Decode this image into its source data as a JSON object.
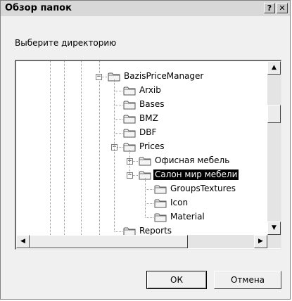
{
  "window": {
    "title": "Обзор папок",
    "help_label": "?",
    "close_label": "✕"
  },
  "prompt": "Выберите директорию",
  "tree": {
    "items": [
      {
        "label": "BazisPriceManager",
        "depth": 0,
        "expanded": true,
        "selected": false
      },
      {
        "label": "Arxib",
        "depth": 1,
        "expanded": null,
        "selected": false
      },
      {
        "label": "Bases",
        "depth": 1,
        "expanded": null,
        "selected": false
      },
      {
        "label": "BMZ",
        "depth": 1,
        "expanded": null,
        "selected": false
      },
      {
        "label": "DBF",
        "depth": 1,
        "expanded": null,
        "selected": false
      },
      {
        "label": "Prices",
        "depth": 1,
        "expanded": true,
        "selected": false
      },
      {
        "label": "Офисная мебель",
        "depth": 2,
        "expanded": false,
        "selected": false
      },
      {
        "label": "Салон мир мебели",
        "depth": 2,
        "expanded": true,
        "selected": true
      },
      {
        "label": "GroupsTextures",
        "depth": 3,
        "expanded": null,
        "selected": false
      },
      {
        "label": "Icon",
        "depth": 3,
        "expanded": null,
        "selected": false
      },
      {
        "label": "Material",
        "depth": 3,
        "expanded": null,
        "selected": false
      },
      {
        "label": "Reports",
        "depth": 1,
        "expanded": null,
        "selected": false
      }
    ]
  },
  "scrollbars": {
    "up_arrow": "▲",
    "down_arrow": "▼",
    "left_arrow": "◀",
    "right_arrow": "▶"
  },
  "buttons": {
    "ok_label": "ОК",
    "cancel_label": "Отмена"
  },
  "colors": {
    "dialog_bg": "#f0f0f0",
    "selection_bg": "#000000",
    "selection_text": "#ffffff"
  },
  "icons": {
    "folder": "folder-icon",
    "expand": "plus-box-icon",
    "collapse": "minus-box-icon"
  }
}
